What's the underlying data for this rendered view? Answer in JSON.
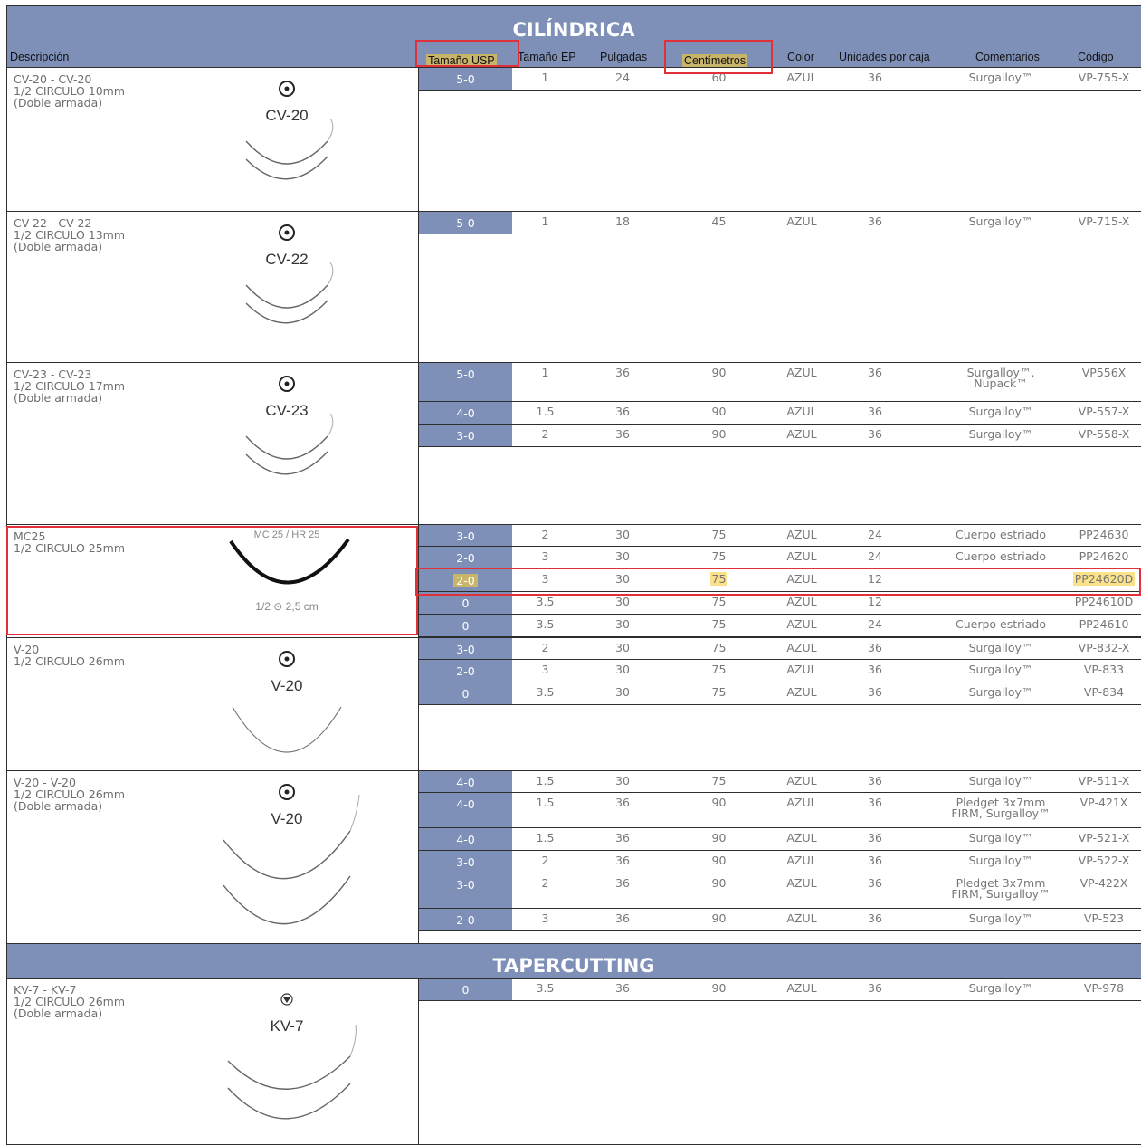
{
  "sections": {
    "cilindrica": "CILÍNDRICA",
    "tapercutting": "TAPERCUTTING"
  },
  "columns": [
    "Descripción",
    "Tamaño USP",
    "Tamaño EP",
    "Pulgadas",
    "Centímetros",
    "Color",
    "Unidades por caja",
    "Comentarios",
    "Código"
  ],
  "groups": [
    {
      "desc": "CV-20 - CV-20\n1/2 CIRCULO 10mm\n(Doble armada)",
      "needle_label": "CV-20",
      "rows": [
        [
          "5-0",
          "1",
          "24",
          "60",
          "AZUL",
          "36",
          "Surgalloy™",
          "VP-755-X"
        ]
      ]
    },
    {
      "desc": "CV-22 - CV-22\n1/2 CIRCULO 13mm\n(Doble armada)",
      "needle_label": "CV-22",
      "rows": [
        [
          "5-0",
          "1",
          "18",
          "45",
          "AZUL",
          "36",
          "Surgalloy™",
          "VP-715-X"
        ]
      ]
    },
    {
      "desc": "CV-23 - CV-23\n1/2 CIRCULO 17mm\n(Doble armada)",
      "needle_label": "CV-23",
      "rows": [
        [
          "5-0",
          "1",
          "36",
          "90",
          "AZUL",
          "36",
          "Surgalloy™,\nNupack™",
          "VP556X"
        ],
        [
          "4-0",
          "1.5",
          "36",
          "90",
          "AZUL",
          "36",
          "Surgalloy™",
          "VP-557-X"
        ],
        [
          "3-0",
          "2",
          "36",
          "90",
          "AZUL",
          "36",
          "Surgalloy™",
          "VP-558-X"
        ]
      ]
    },
    {
      "desc": "MC25\n1/2 CIRCULO 25mm",
      "needle_label": "MC 25 / HR 25",
      "needle_caption": "1/2 ⊙ 2,5 cm",
      "rows": [
        [
          "3-0",
          "2",
          "30",
          "75",
          "AZUL",
          "24",
          "Cuerpo estriado",
          "PP24630"
        ],
        [
          "2-0",
          "3",
          "30",
          "75",
          "AZUL",
          "24",
          "Cuerpo estriado",
          "PP24620"
        ],
        [
          "2-0",
          "3",
          "30",
          "75",
          "AZUL",
          "12",
          "",
          "PP24620D"
        ],
        [
          "0",
          "3.5",
          "30",
          "75",
          "AZUL",
          "12",
          "",
          "PP24610D"
        ],
        [
          "0",
          "3.5",
          "30",
          "75",
          "AZUL",
          "24",
          "Cuerpo estriado",
          "PP24610"
        ]
      ]
    },
    {
      "desc": "V-20\n1/2 CIRCULO 26mm",
      "needle_label": "V-20",
      "rows": [
        [
          "3-0",
          "2",
          "30",
          "75",
          "AZUL",
          "36",
          "Surgalloy™",
          "VP-832-X"
        ],
        [
          "2-0",
          "3",
          "30",
          "75",
          "AZUL",
          "36",
          "Surgalloy™",
          "VP-833"
        ],
        [
          "0",
          "3.5",
          "30",
          "75",
          "AZUL",
          "36",
          "Surgalloy™",
          "VP-834"
        ]
      ]
    },
    {
      "desc": "V-20 - V-20\n1/2 CIRCULO 26mm\n(Doble armada)",
      "needle_label": "V-20",
      "rows": [
        [
          "4-0",
          "1.5",
          "30",
          "75",
          "AZUL",
          "36",
          "Surgalloy™",
          "VP-511-X"
        ],
        [
          "4-0",
          "1.5",
          "36",
          "90",
          "AZUL",
          "36",
          "Pledget 3x7mm\nFIRM, Surgalloy™",
          "VP-421X"
        ],
        [
          "4-0",
          "1.5",
          "36",
          "90",
          "AZUL",
          "36",
          "Surgalloy™",
          "VP-521-X"
        ],
        [
          "3-0",
          "2",
          "36",
          "90",
          "AZUL",
          "36",
          "Surgalloy™",
          "VP-522-X"
        ],
        [
          "3-0",
          "2",
          "36",
          "90",
          "AZUL",
          "36",
          "Pledget 3x7mm\nFIRM, Surgalloy™",
          "VP-422X"
        ],
        [
          "2-0",
          "3",
          "36",
          "90",
          "AZUL",
          "36",
          "Surgalloy™",
          "VP-523"
        ]
      ]
    },
    {
      "desc": "KV-7 - KV-7\n1/2 CIRCULO 26mm\n(Doble armada)",
      "needle_label": "KV-7",
      "rows": [
        [
          "0",
          "3.5",
          "36",
          "90",
          "AZUL",
          "36",
          "Surgalloy™",
          "VP-978"
        ]
      ]
    }
  ]
}
